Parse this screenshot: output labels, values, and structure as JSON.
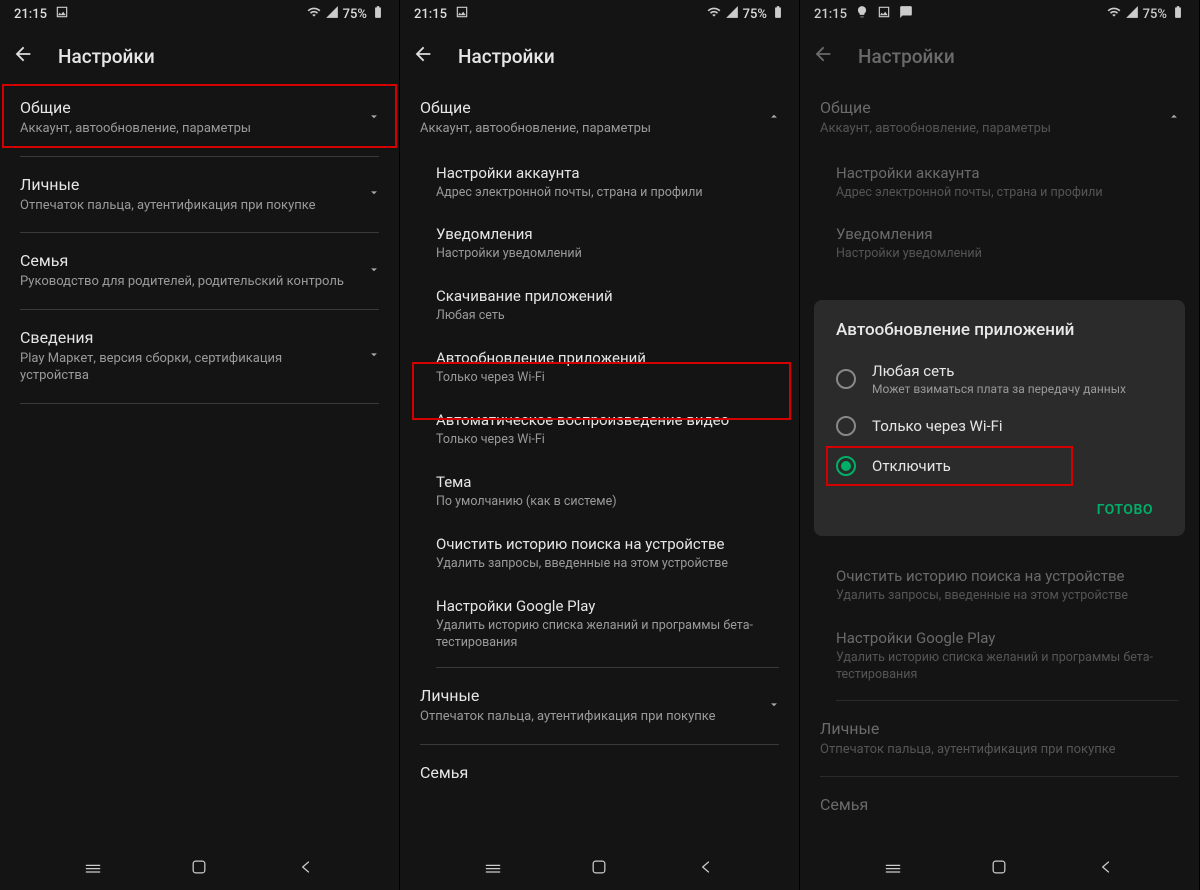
{
  "status": {
    "time": "21:15",
    "battery": "75%"
  },
  "header": {
    "title": "Настройки"
  },
  "screen1": {
    "s0": {
      "title": "Общие",
      "sub": "Аккаунт, автообновление, параметры"
    },
    "s1": {
      "title": "Личные",
      "sub": "Отпечаток пальца, аутентификация при покупке"
    },
    "s2": {
      "title": "Семья",
      "sub": "Руководство для родителей, родительский контроль"
    },
    "s3": {
      "title": "Сведения",
      "sub": "Play Маркет, версия сборки, сертификация устройства"
    }
  },
  "screen2": {
    "s0": {
      "title": "Общие",
      "sub": "Аккаунт, автообновление, параметры"
    },
    "sub0": {
      "title": "Настройки аккаунта",
      "sub": "Адрес электронной почты, страна и профили"
    },
    "sub1": {
      "title": "Уведомления",
      "sub": "Настройки уведомлений"
    },
    "sub2": {
      "title": "Скачивание приложений",
      "sub": "Любая сеть"
    },
    "sub3": {
      "title": "Автообновление приложений",
      "sub": "Только через Wi-Fi"
    },
    "sub4": {
      "title": "Автоматическое воспроизведение видео",
      "sub": "Только через Wi-Fi"
    },
    "sub5": {
      "title": "Тема",
      "sub": "По умолчанию (как в системе)"
    },
    "sub6": {
      "title": "Очистить историю поиска на устройстве",
      "sub": "Удалить запросы, введенные на этом устройстве"
    },
    "sub7": {
      "title": "Настройки Google Play",
      "sub": "Удалить историю списка желаний и программы бета-тестирования"
    },
    "s1": {
      "title": "Личные",
      "sub": "Отпечаток пальца, аутентификация при покупке"
    },
    "s2": {
      "title": "Семья",
      "sub": ""
    }
  },
  "dialog": {
    "title": "Автообновление приложений",
    "opt0": {
      "label": "Любая сеть",
      "sub": "Может взиматься плата за передачу данных"
    },
    "opt1": {
      "label": "Только через Wi-Fi"
    },
    "opt2": {
      "label": "Отключить"
    },
    "action": "ГОТОВО"
  }
}
